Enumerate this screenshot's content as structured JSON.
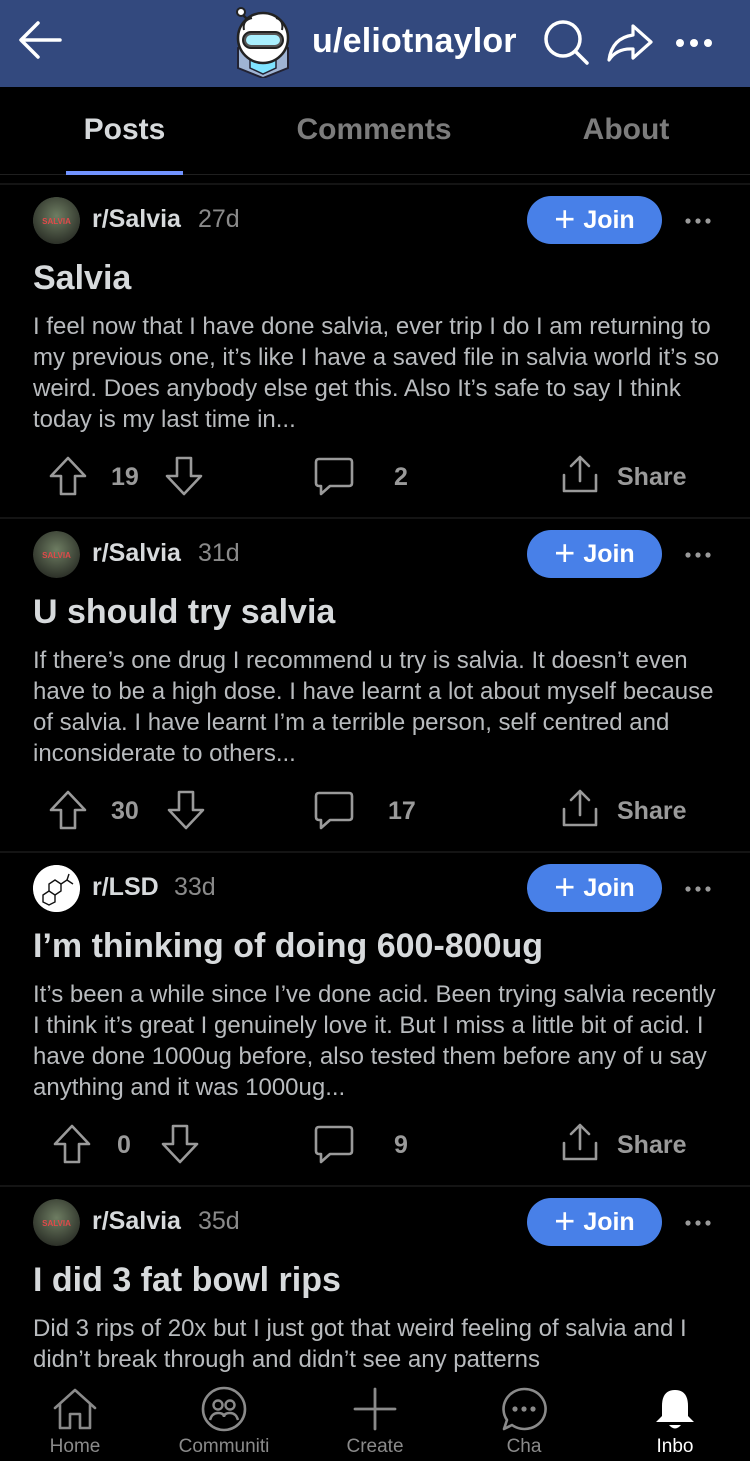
{
  "header": {
    "username": "u/eliotnaylor"
  },
  "tabs": [
    {
      "label": "Posts",
      "active": true
    },
    {
      "label": "Comments",
      "active": false
    },
    {
      "label": "About",
      "active": false
    }
  ],
  "posts": [
    {
      "subreddit": "r/Salvia",
      "sub_icon_text": "SALVIA",
      "age": "27d",
      "join_label": "Join",
      "title": "Salvia",
      "body": "I feel now that I have done salvia, ever trip I do I am returning to my previous one, it’s like I have a saved file in salvia world it’s so weird. Does anybody else get this. Also It’s safe to say I think today is my last time in...",
      "votes": "19",
      "comments": "2",
      "share_label": "Share"
    },
    {
      "subreddit": "r/Salvia",
      "sub_icon_text": "SALVIA",
      "age": "31d",
      "join_label": "Join",
      "title": "U should try salvia",
      "body": "If there’s one drug I recommend u try is salvia. It doesn’t even have to be a high dose. I have learnt a lot about myself because of salvia. I have learnt I’m a terrible person, self centred and inconsiderate to others...",
      "votes": "30",
      "comments": "17",
      "share_label": "Share"
    },
    {
      "subreddit": "r/LSD",
      "sub_icon_text": "",
      "age": "33d",
      "join_label": "Join",
      "title": "I’m thinking of doing 600-800ug",
      "body": "It’s been a while since I’ve done acid. Been trying salvia recently I think it’s great I genuinely love it. But I miss a little bit of acid. I have done 1000ug before, also tested them before any of u say anything and it was 1000ug...",
      "votes": "0",
      "comments": "9",
      "share_label": "Share"
    },
    {
      "subreddit": "r/Salvia",
      "sub_icon_text": "SALVIA",
      "age": "35d",
      "join_label": "Join",
      "title": "I did 3 fat bowl rips",
      "body": "Did 3 rips of 20x but I just got that weird feeling of salvia and I didn’t break through and didn’t see any patterns",
      "votes": "",
      "comments": "",
      "share_label": ""
    }
  ],
  "bottom_nav": [
    {
      "label": "Home",
      "icon": "home-icon"
    },
    {
      "label": "Communiti",
      "icon": "communities-icon"
    },
    {
      "label": "Create",
      "icon": "create-icon"
    },
    {
      "label": "Cha",
      "icon": "chat-icon"
    },
    {
      "label": "Inbo",
      "icon": "bell-icon",
      "active": true
    }
  ],
  "colors": {
    "header_bg": "#33497e",
    "join_bg": "#4880e8",
    "tab_underline": "#7193ff",
    "background": "#000000"
  }
}
